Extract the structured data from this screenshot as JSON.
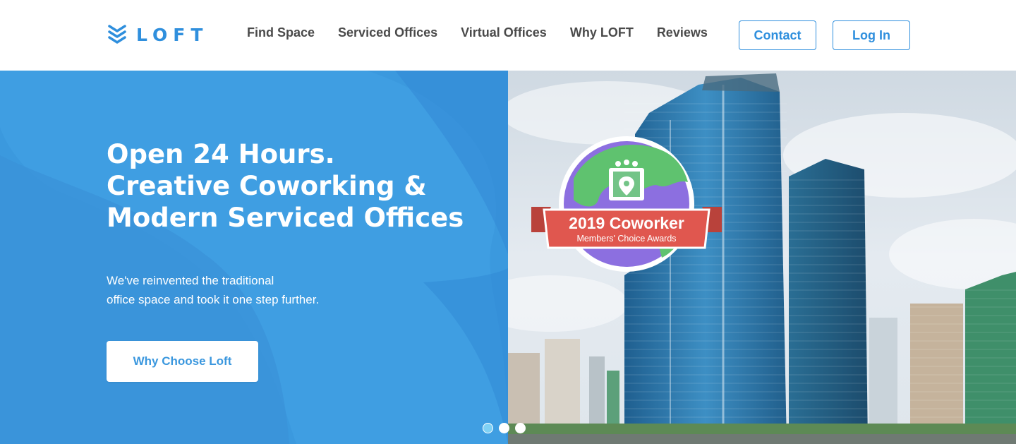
{
  "brand": {
    "name": "LOFT",
    "icon": "chevron-stack-icon",
    "color": "#2f8fdd"
  },
  "nav": {
    "items": [
      "Find Space",
      "Serviced Offices",
      "Virtual Offices",
      "Why LOFT",
      "Reviews"
    ]
  },
  "header_buttons": {
    "contact": "Contact",
    "login": "Log In"
  },
  "hero": {
    "title_lines": [
      "Open 24 Hours.",
      "Creative Coworking &",
      "Modern Serviced Offices"
    ],
    "subtitle_lines": [
      "We've reinvented the traditional",
      "office space and took it one step further."
    ],
    "cta": "Why Choose Loft",
    "accent_color": "#3a97de"
  },
  "badge": {
    "title": "2019 Coworker",
    "subtitle": "Members' Choice Awards",
    "ribbon_color": "#e0574f",
    "globe_color": "#8c6fe0",
    "icon": "map-pin-icon"
  },
  "carousel": {
    "slides": 3,
    "active_index": 0
  }
}
